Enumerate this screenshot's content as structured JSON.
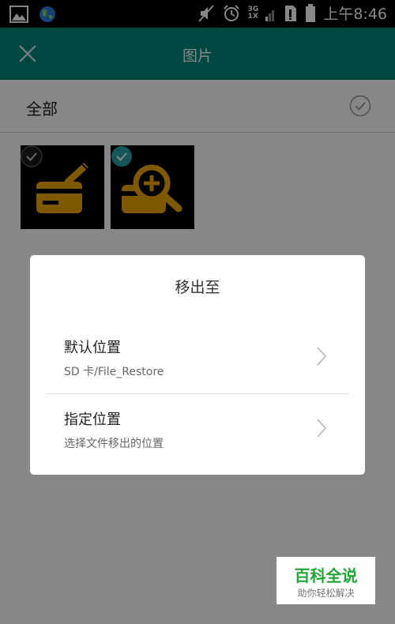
{
  "status_bar": {
    "time": "上午8:46",
    "network_top": "3G",
    "network_bottom": "1X",
    "icons": [
      "image-icon",
      "globe-icon",
      "mute-icon",
      "alarm-icon",
      "signal-icon",
      "sim-icon",
      "battery-icon"
    ]
  },
  "app_bar": {
    "title": "图片",
    "close_icon": "close-icon",
    "color": "#00877d"
  },
  "select_all": {
    "label": "全部",
    "checked": false
  },
  "thumbnails": [
    {
      "icon": "card-with-pen-icon",
      "checked": false
    },
    {
      "icon": "card-with-magnifier-icon",
      "checked": true
    }
  ],
  "dialog": {
    "title": "移出至",
    "options": [
      {
        "title": "默认位置",
        "subtitle": "SD 卡/File_Restore"
      },
      {
        "title": "指定位置",
        "subtitle": "选择文件移出的位置"
      }
    ]
  },
  "watermark": {
    "title": "百科全说",
    "subtitle": "助你轻松解决"
  },
  "colors": {
    "accent": "#00877d",
    "check_teal": "#2aa3a8",
    "thumbnail_icon": "#f0a900"
  }
}
